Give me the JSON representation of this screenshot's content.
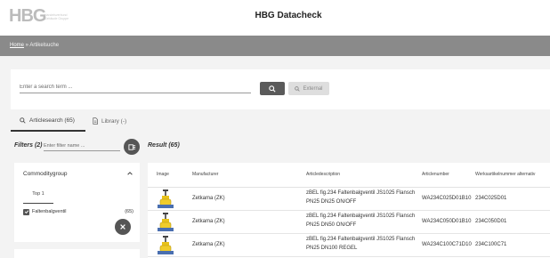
{
  "header": {
    "logo_text": "HBG",
    "logo_sub": "Handelsverbund Gebäude Gruppe",
    "app_title": "HBG Datacheck"
  },
  "breadcrumb": {
    "home": "Home",
    "separator": " » ",
    "current": "Artikelsuche"
  },
  "search": {
    "placeholder": "Enter a search term ...",
    "value": "",
    "search_icon": "search-icon",
    "external_label": "External"
  },
  "tabs": [
    {
      "label": "Articlesearch (65)",
      "icon": "search-icon",
      "active": true
    },
    {
      "label": "Library (-)",
      "icon": "document-icon",
      "active": false
    }
  ],
  "filters": {
    "title": "Filters (2)",
    "filter_placeholder": "Enter filter name ..."
  },
  "result": {
    "title": "Result (65)"
  },
  "facet": {
    "title": "Commoditygroup",
    "top_label": "Top 1",
    "items": [
      {
        "label": "Faltenbalgventil",
        "count": "(65)",
        "checked": true
      }
    ]
  },
  "table": {
    "columns": [
      "Image",
      "Manufacturer",
      "Articledescription",
      "Articlenumber",
      "Werksartikelnummer alternativ"
    ],
    "rows": [
      {
        "manufacturer": "Zetkama (ZK)",
        "desc_line1": "zBEL fig.234 Faltenbalgventil JS1025 Flansch",
        "desc_line2": "PN25 DN25 ON/OFF",
        "articlenumber": "WA234C025D01B10",
        "werks": "234C025D01"
      },
      {
        "manufacturer": "Zetkama (ZK)",
        "desc_line1": "zBEL fig.234 Faltenbalgventil JS1025 Flansch",
        "desc_line2": "PN25 DN50 ON/OFF",
        "articlenumber": "WA234C050D01B10",
        "werks": "234C050D01"
      },
      {
        "manufacturer": "Zetkama (ZK)",
        "desc_line1": "zBEL fig.234 Faltenbalgventil JS1025 Flansch",
        "desc_line2": "PN25 DN100 REGEL",
        "articlenumber": "WA234C100C71D10",
        "werks": "234C100C71"
      }
    ]
  },
  "colors": {
    "breadcrumb_bar": "#8a8a8a",
    "dark_button": "#5a5a5a",
    "valve_yellow": "#e8c21a"
  }
}
